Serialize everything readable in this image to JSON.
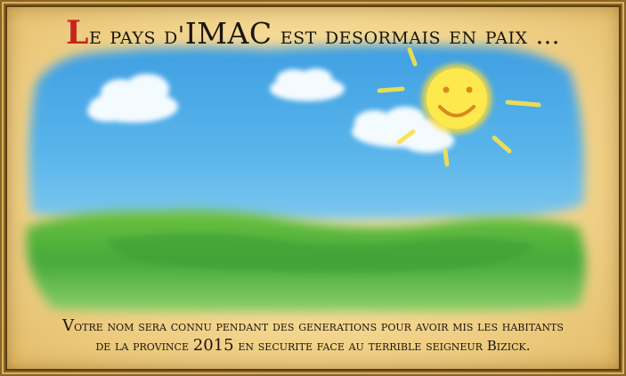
{
  "title": {
    "initial": "L",
    "before": "e pays d'",
    "brand": "IMAC",
    "after": " est desormais en paix ..."
  },
  "message": {
    "line1_initial": "V",
    "line1_rest": "otre nom sera connu pendant des generations pour avoir mis les habitants",
    "line2_before": "de la province ",
    "line2_year": "2015",
    "line2_after": " en securite face au terrible seigneur Bizick."
  },
  "colors": {
    "sky": "#4aa8e6",
    "grass": "#4fb03a",
    "sun": "#fbe54a",
    "parchment": "#f3d68f",
    "frame": "#8a6526",
    "accent_red": "#c8231c"
  }
}
